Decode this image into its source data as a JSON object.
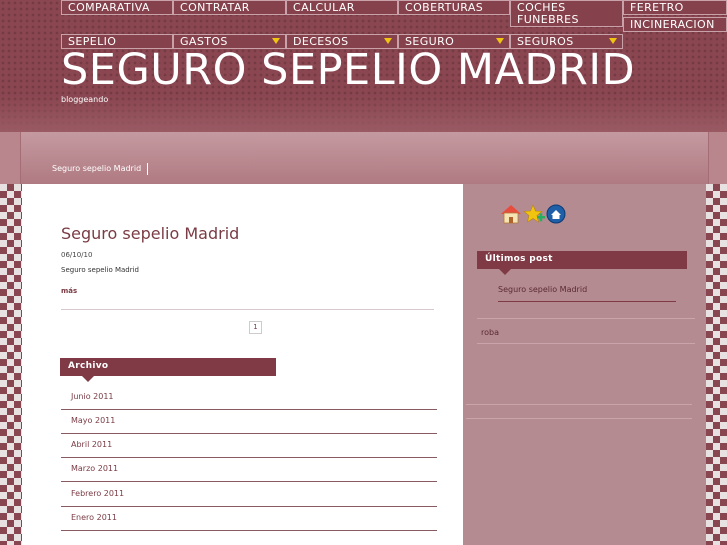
{
  "nav": {
    "comparativa": "COMPARATIVA",
    "contratar": "CONTRATAR",
    "calcular": "CALCULAR",
    "coberturas": "COBERTURAS",
    "coches": "COCHES FUNEBRES",
    "feretro": "FERETRO",
    "incineracion": "INCINERACION",
    "sepelio": "SEPELIO",
    "gastos": "GASTOS",
    "decesos": "DECESOS",
    "seguro": "SEGURO",
    "seguros": "SEGUROS"
  },
  "site": {
    "title": "SEGURO SEPELIO MADRID",
    "tagline": "bloggeando"
  },
  "breadcrumb": "Seguro sepelio Madrid",
  "post": {
    "title": "Seguro sepelio Madrid",
    "date": "06/10/10",
    "body": "Seguro sepelio Madrid",
    "more": "más"
  },
  "pager": "1",
  "archive": {
    "title": "Archivo",
    "items": [
      "Junio 2011",
      "Mayo 2011",
      "Abril 2011",
      "Marzo 2011",
      "Febrero 2011",
      "Enero 2011"
    ]
  },
  "sidebar": {
    "icons": [
      "home-icon",
      "add-favorite-icon",
      "set-homepage-icon"
    ],
    "recent_title": "Últimos post",
    "recent_items": [
      "Seguro sepelio Madrid"
    ],
    "extra_text": "roba"
  },
  "colors": {
    "brand": "#7f3a45",
    "header_bg": "#8a4651",
    "sidebar_bg": "#b58b92",
    "link": "#7a3b44",
    "nav_arrow": "#f1c40f"
  }
}
